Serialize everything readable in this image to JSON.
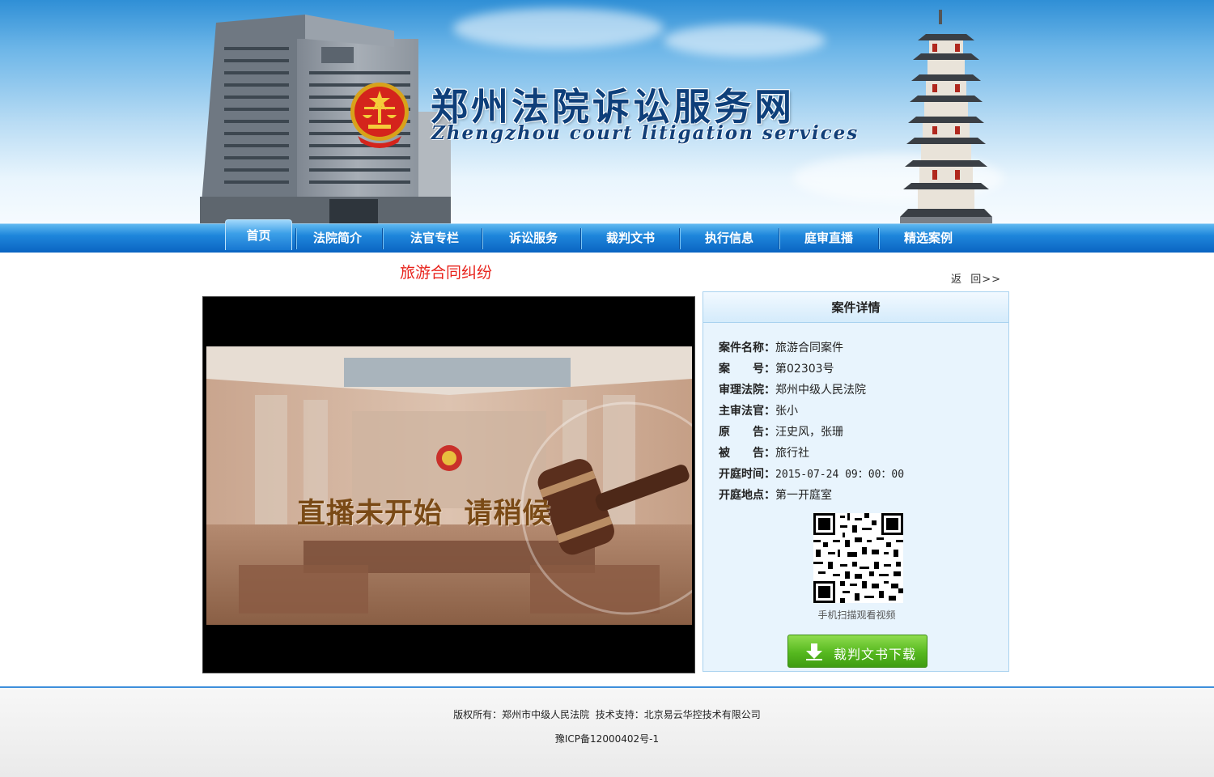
{
  "header": {
    "title": "郑州法院诉讼服务网",
    "subtitle": "Zhengzhou court litigation services"
  },
  "nav": {
    "items": [
      {
        "label": "首页",
        "active": true
      },
      {
        "label": "法院简介"
      },
      {
        "label": "法官专栏"
      },
      {
        "label": "诉讼服务"
      },
      {
        "label": "裁判文书"
      },
      {
        "label": "执行信息"
      },
      {
        "label": "庭审直播"
      },
      {
        "label": "精选案例"
      }
    ]
  },
  "main": {
    "case_title": "旅游合同纠纷",
    "back_link": "返  回>>",
    "video": {
      "message": "直播未开始  请稍候"
    },
    "details": {
      "heading": "案件详情",
      "rows": [
        {
          "label": "案件名称：",
          "value": "旅游合同案件"
        },
        {
          "label": "案　　号：",
          "value": "第02303号"
        },
        {
          "label": "审理法院：",
          "value": "郑州中级人民法院"
        },
        {
          "label": "主审法官：",
          "value": "张小"
        },
        {
          "label": "原　　告：",
          "value": "汪史风，张珊"
        },
        {
          "label": "被　　告：",
          "value": "旅行社"
        },
        {
          "label": "开庭时间：",
          "value": "2015-07-24 09：00：00"
        },
        {
          "label": "开庭地点：",
          "value": "第一开庭室"
        }
      ],
      "qr_caption": "手机扫描观看视频",
      "download_label": "裁判文书下载"
    }
  },
  "footer": {
    "line1": "版权所有：郑州市中级人民法院  技术支持：北京易云华控技术有限公司",
    "line2": "豫ICP备12000402号-1"
  },
  "colors": {
    "nav_blue": "#0a64c2",
    "title_red": "#e8231c",
    "panel_bg": "#e8f4fd",
    "download_green": "#56b81f"
  }
}
